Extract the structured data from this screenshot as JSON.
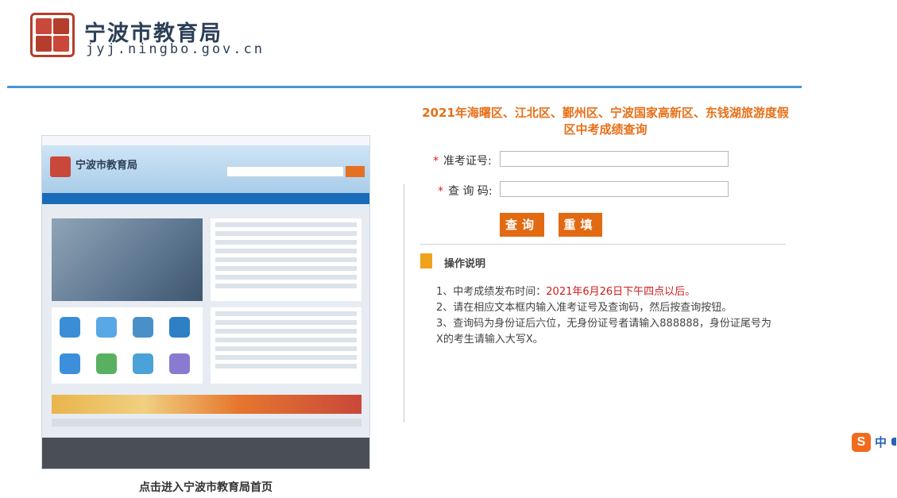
{
  "header": {
    "title": "宁波市教育局",
    "domain": "jyj.ningbo.gov.cn"
  },
  "thumbnail": {
    "caption": "点击进入宁波市教育局首页",
    "site_title": "宁波市教育局"
  },
  "query": {
    "title": "2021年海曙区、江北区、鄞州区、宁波国家高新区、东钱湖旅游度假区中考成绩查询",
    "fields": [
      {
        "required_mark": "*",
        "label": "准考证号:",
        "value": ""
      },
      {
        "required_mark": "*",
        "label": "查 询 码:",
        "value": ""
      }
    ],
    "buttons": {
      "query": "查询",
      "reset": "重填"
    }
  },
  "instructions": {
    "title": "操作说明",
    "item1_prefix": "1、中考成绩发布时间：",
    "item1_highlight": "2021年6月26日下午四点以后。",
    "item2": "2、请在相应文本框内输入准考证号及查询码，然后按查询按钮。",
    "item3": "3、查询码为身份证后六位，无身份证号者请输入888888，身份证尾号为X的考生请输入大写X。"
  },
  "ime": {
    "logo": "S",
    "lang": "中"
  },
  "colors": {
    "accent": "#e26a12",
    "highlight": "#d01a1a",
    "header_line": "#4b93d6",
    "title_text": "#2c3f57"
  }
}
